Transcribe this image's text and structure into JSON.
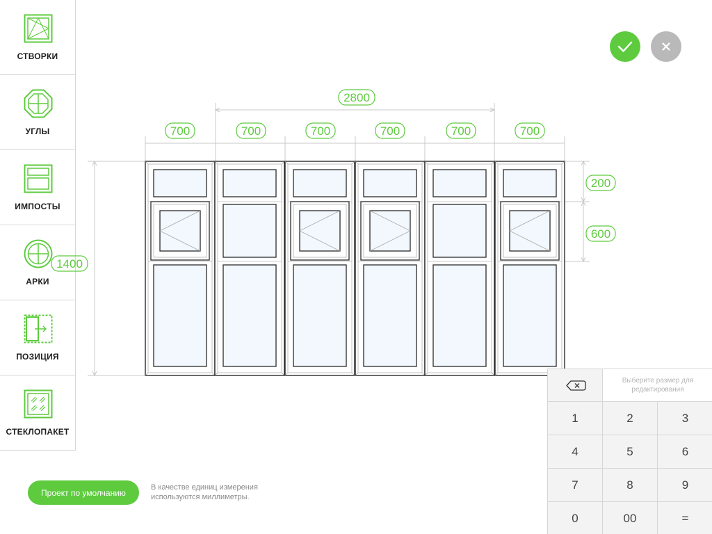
{
  "sidebar": {
    "items": [
      {
        "label": "СТВОРКИ",
        "icon": "sash-icon"
      },
      {
        "label": "УГЛЫ",
        "icon": "corners-icon"
      },
      {
        "label": "ИМПОСТЫ",
        "icon": "mullions-icon"
      },
      {
        "label": "АРКИ",
        "icon": "arch-icon"
      },
      {
        "label": "ПОЗИЦИЯ",
        "icon": "position-icon"
      },
      {
        "label": "СТЕКЛОПАКЕТ",
        "icon": "glass-unit-icon"
      }
    ]
  },
  "actions": {
    "confirm_icon": "checkmark-icon",
    "cancel_icon": "close-icon"
  },
  "dimensions": {
    "overall_width": "2800",
    "section_widths": [
      "700",
      "700",
      "700",
      "700",
      "700",
      "700"
    ],
    "overall_height": "1400",
    "transom_height": "200",
    "middle_height": "600"
  },
  "keypad": {
    "hint": "Выберите размер для редактирования",
    "backspace_icon": "backspace-icon",
    "rows": [
      [
        "1",
        "2",
        "3"
      ],
      [
        "4",
        "5",
        "6"
      ],
      [
        "7",
        "8",
        "9"
      ],
      [
        "0",
        "00",
        "="
      ]
    ]
  },
  "footer": {
    "default_project_label": "Проект по умолчанию",
    "units_note": "В качестве единиц измерения используются миллиметры."
  },
  "colors": {
    "accent": "#5ecb3f",
    "cancel": "#b9b9b9",
    "dimension": "#5ecb3f",
    "glass": "#f2f8fd",
    "frame": "#2b2b2b"
  }
}
